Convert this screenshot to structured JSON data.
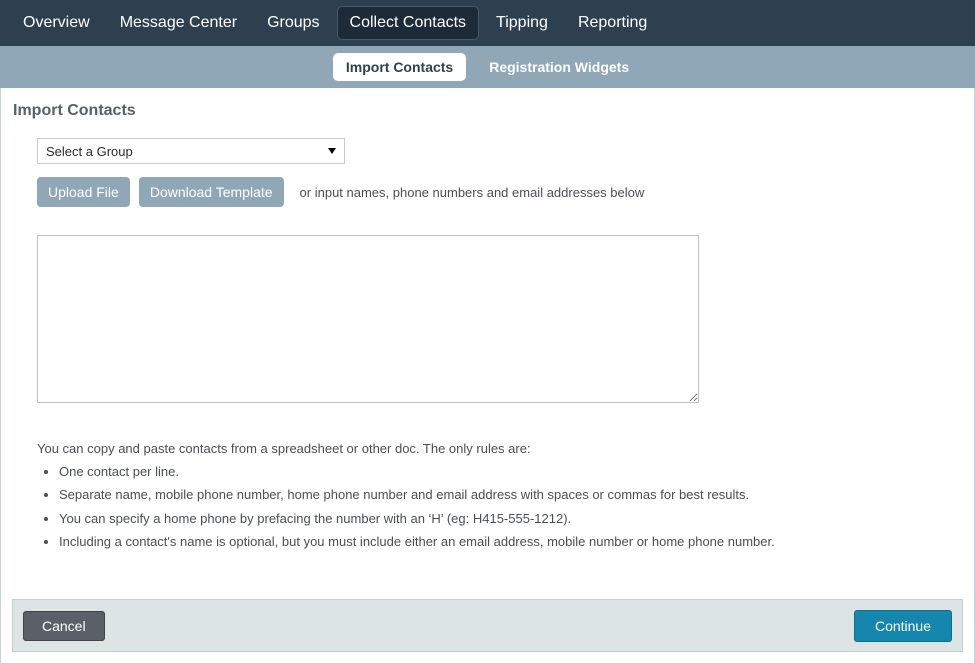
{
  "topnav": {
    "items": [
      {
        "label": "Overview",
        "active": false
      },
      {
        "label": "Message Center",
        "active": false
      },
      {
        "label": "Groups",
        "active": false
      },
      {
        "label": "Collect Contacts",
        "active": true
      },
      {
        "label": "Tipping",
        "active": false
      },
      {
        "label": "Reporting",
        "active": false
      }
    ]
  },
  "subnav": {
    "items": [
      {
        "label": "Import Contacts",
        "active": true
      },
      {
        "label": "Registration Widgets",
        "active": false
      }
    ]
  },
  "page": {
    "title": "Import Contacts"
  },
  "group_select": {
    "selected": "Select a Group",
    "options": [
      "Select a Group"
    ],
    "arrow_icon": "chevron-down-icon"
  },
  "upload": {
    "upload_file_label": "Upload File",
    "download_template_label": "Download Template",
    "hint": "or input names, phone numbers and email addresses below"
  },
  "contacts_input": {
    "value": "",
    "placeholder": ""
  },
  "instructions": {
    "intro": "You can copy and paste contacts from a spreadsheet or other doc. The only rules are:",
    "rules": [
      "One contact per line.",
      "Separate name, mobile phone number, home phone number and email address with spaces or commas for best results.",
      "You can specify a home phone by prefacing the number with an ‘H’ (eg: H415-555-1212).",
      "Including a contact's name is optional, but you must include either an email address, mobile number or home phone number."
    ]
  },
  "footer": {
    "cancel_label": "Cancel",
    "continue_label": "Continue"
  },
  "colors": {
    "topnav_bg": "#2e3f4f",
    "topnav_active_bg": "#1d2b38",
    "subnav_bg": "#90a7b7",
    "button_grey": "#90a7b7",
    "cancel_grey": "#5a6068",
    "continue_teal": "#1586ad",
    "footer_bg": "#dde5e4"
  }
}
